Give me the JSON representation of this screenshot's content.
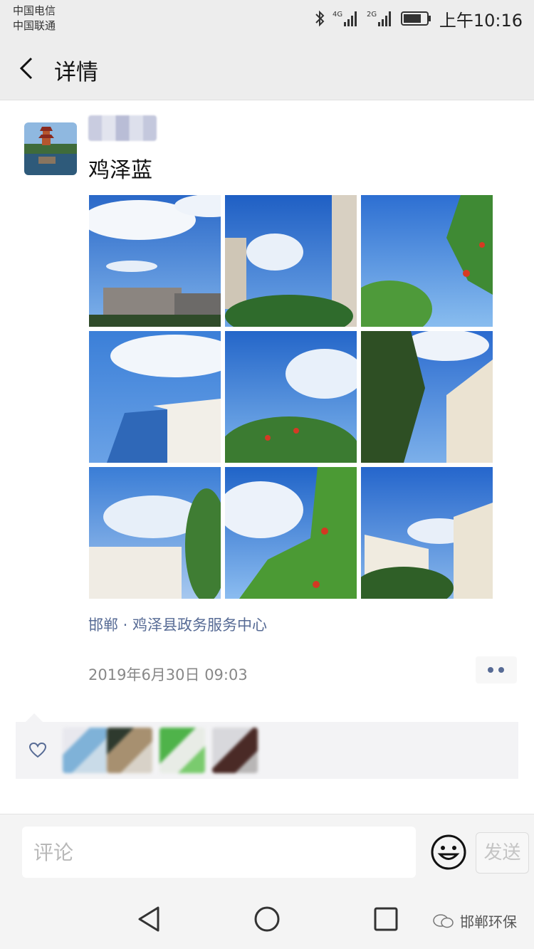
{
  "status_bar": {
    "carrier_1": "中国电信",
    "carrier_2": "中国联通",
    "signal_1": "4G",
    "signal_2": "2G",
    "time": "上午10:16"
  },
  "header": {
    "title": "详情",
    "back_icon": "back-chevron-icon"
  },
  "post": {
    "text": "鸡泽蓝",
    "location": "邯郸 · 鸡泽县政务服务中心",
    "timestamp": "2019年6月30日 09:03",
    "photos": [
      {
        "alt": "sky-photo-1"
      },
      {
        "alt": "sky-photo-2"
      },
      {
        "alt": "sky-photo-3"
      },
      {
        "alt": "sky-photo-4"
      },
      {
        "alt": "sky-photo-5"
      },
      {
        "alt": "sky-photo-6"
      },
      {
        "alt": "sky-photo-7"
      },
      {
        "alt": "sky-photo-8"
      },
      {
        "alt": "sky-photo-9"
      }
    ]
  },
  "likes": {
    "icon": "heart-icon",
    "count_visible": 4
  },
  "comment": {
    "placeholder": "评论",
    "send_label": "发送",
    "emoji_icon": "smiley-icon"
  },
  "system_nav": {
    "back": "triangle-back-icon",
    "home": "circle-home-icon",
    "recents": "square-recents-icon"
  },
  "watermark": {
    "text": "邯郸环保"
  },
  "colors": {
    "link": "#576b95",
    "header_bg": "#ededed",
    "sky": "#2f6fd0"
  }
}
